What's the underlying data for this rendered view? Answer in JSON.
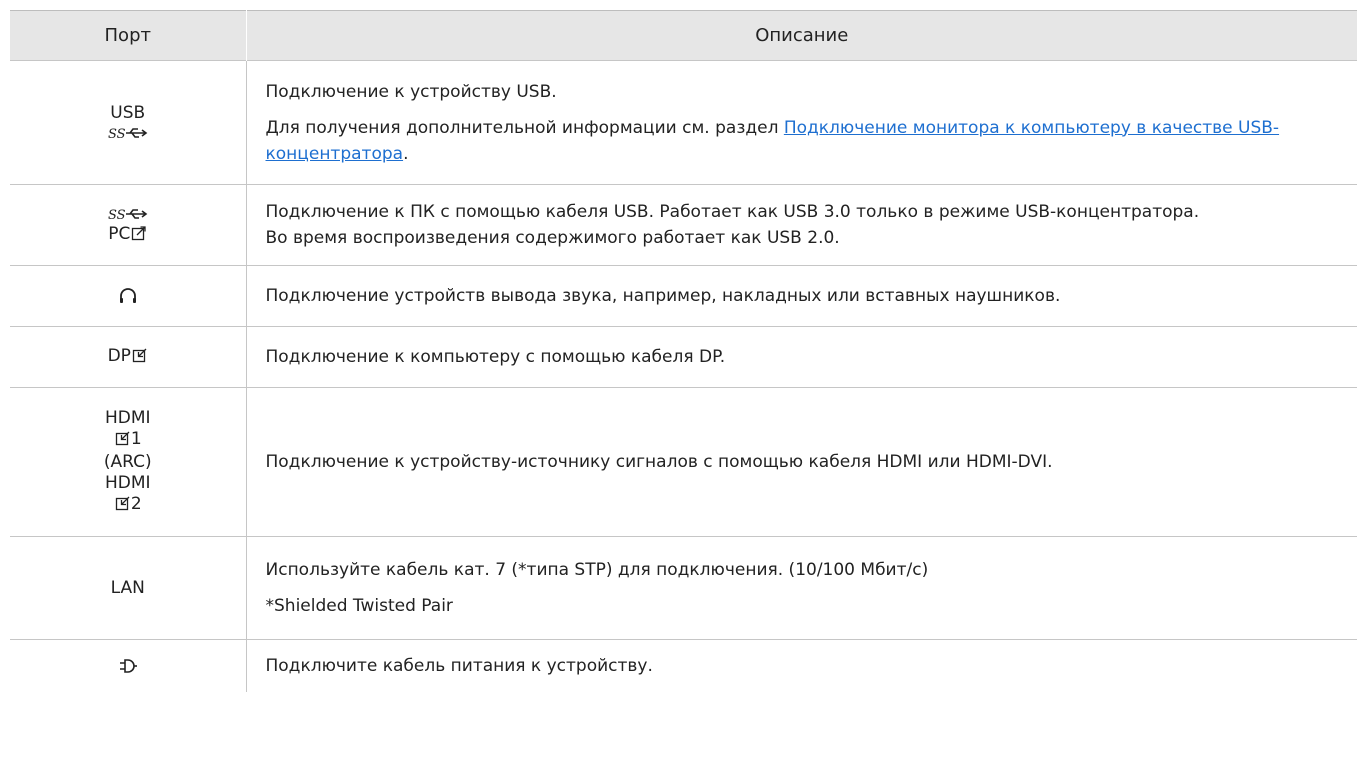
{
  "header": {
    "port": "Порт",
    "description": "Описание"
  },
  "rows": [
    {
      "port_text": "USB",
      "icon": "superspeed-usb-icon",
      "desc1": "Подключение к устройству USB.",
      "desc2_prefix": "Для получения дополнительной информации см. раздел ",
      "desc2_link": "Подключение монитора к компьютеру в качестве USB-концентратора",
      "desc2_suffix": "."
    },
    {
      "icon": "superspeed-usb-icon",
      "port_text": "PC",
      "port_icon": "output-arrow-icon",
      "desc1": "Подключение к ПК с помощью кабеля USB. Работает как USB 3.0 только в режиме USB-концентратора.",
      "desc2": "Во время воспроизведения содержимого работает как USB 2.0."
    },
    {
      "icon": "headphone-icon",
      "desc1": "Подключение устройств вывода звука, например, накладных или вставных наушников."
    },
    {
      "port_text": "DP",
      "port_icon": "input-arrow-icon",
      "desc1": "Подключение к компьютеру с помощью кабеля DP."
    },
    {
      "hdmi1_label": "HDMI",
      "hdmi1_num": "1",
      "hdmi1_arc": "(ARC)",
      "hdmi2_label": "HDMI",
      "hdmi2_num": "2",
      "port_icon": "input-arrow-icon",
      "desc1": "Подключение к устройству-источнику сигналов с помощью кабеля HDMI или HDMI-DVI."
    },
    {
      "port_text": "LAN",
      "desc1": "Используйте кабель кат. 7 (*типа STP) для подключения. (10/100 Мбит/с)",
      "desc2": "*Shielded Twisted Pair"
    },
    {
      "icon": "power-plug-icon",
      "desc1": "Подключите кабель питания к устройству."
    }
  ]
}
